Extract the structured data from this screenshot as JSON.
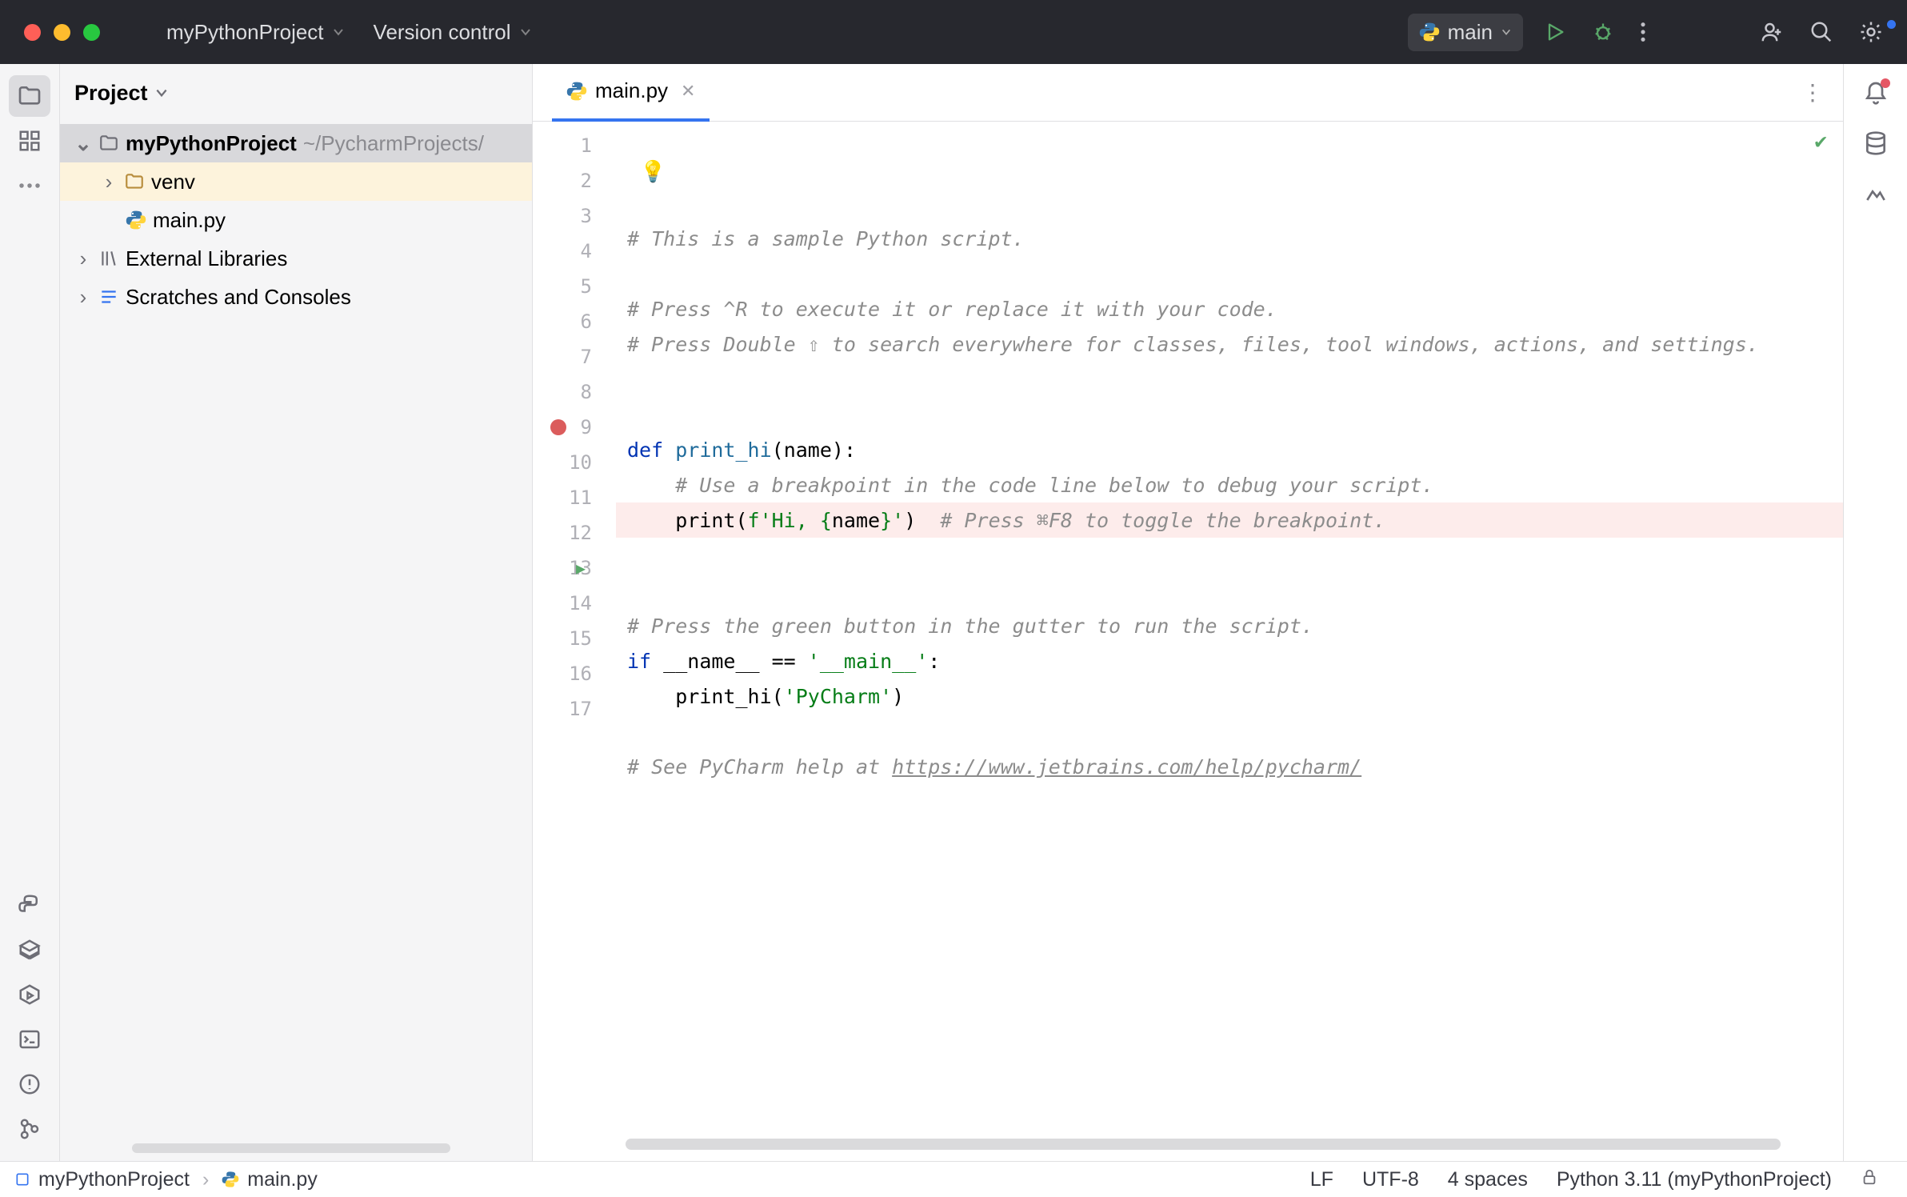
{
  "titlebar": {
    "project_name": "myPythonProject",
    "vcs_label": "Version control",
    "run_config": "main"
  },
  "project_panel": {
    "title": "Project",
    "root": {
      "name": "myPythonProject",
      "path": "~/PycharmProjects/"
    },
    "venv": "venv",
    "file": "main.py",
    "ext_libs": "External Libraries",
    "scratches": "Scratches and Consoles"
  },
  "tab": {
    "file": "main.py"
  },
  "code": {
    "lines": [
      "# This is a sample Python script.",
      "",
      "# Press ^R to execute it or replace it with your code.",
      "# Press Double ⇧ to search everywhere for classes, files, tool windows, actions, and settings.",
      "",
      "",
      "def print_hi(name):",
      "    # Use a breakpoint in the code line below to debug your script.",
      "    print(f'Hi, {name}')  # Press ⌘F8 to toggle the breakpoint.",
      "",
      "",
      "# Press the green button in the gutter to run the script.",
      "if __name__ == '__main__':",
      "    print_hi('PyCharm')",
      "",
      "# See PyCharm help at https://www.jetbrains.com/help/pycharm/",
      ""
    ],
    "breakpoint_line": 9,
    "run_gutter_line": 13,
    "link_text": "https://www.jetbrains.com/help/pycharm/"
  },
  "statusbar": {
    "crumb1": "myPythonProject",
    "crumb2": "main.py",
    "line_sep": "LF",
    "encoding": "UTF-8",
    "indent": "4 spaces",
    "interpreter": "Python 3.11 (myPythonProject)"
  }
}
